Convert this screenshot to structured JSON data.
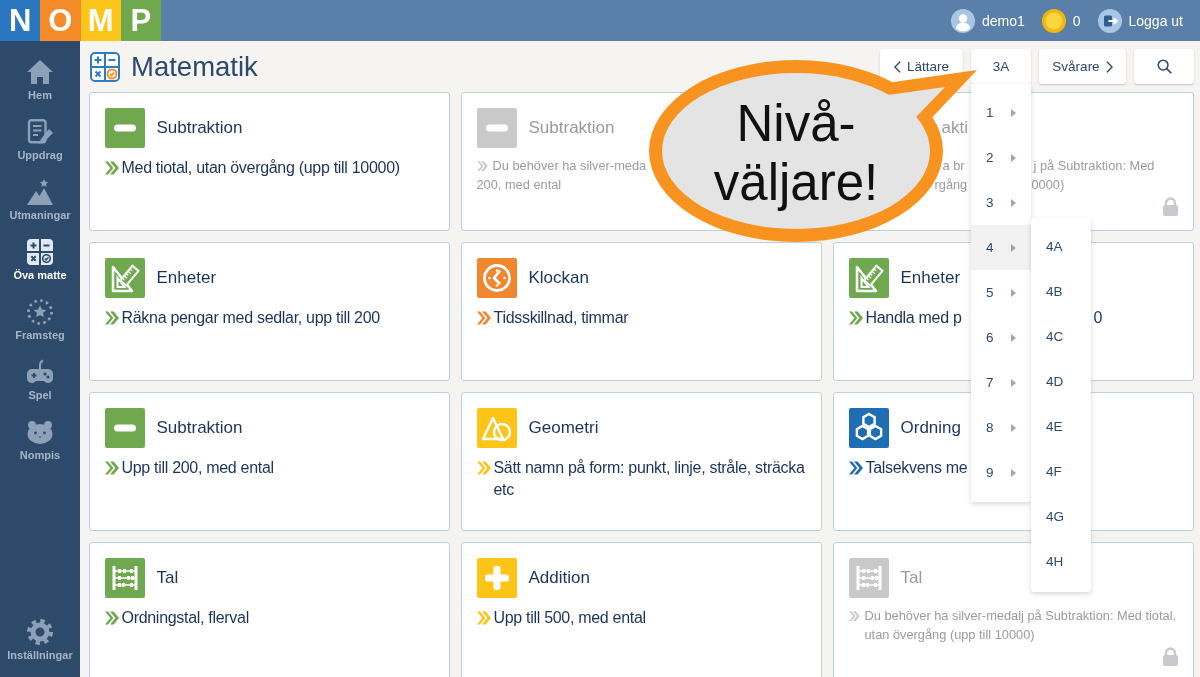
{
  "top_bar": {
    "logo": [
      {
        "letter": "N",
        "color": "#2b76c0"
      },
      {
        "letter": "O",
        "color": "#f58a2a"
      },
      {
        "letter": "M",
        "color": "#fcc51a"
      },
      {
        "letter": "P",
        "color": "#70a84e"
      }
    ],
    "user": "demo1",
    "coins": "0",
    "logout": "Logga ut"
  },
  "sidebar": {
    "items": [
      {
        "kind": "home",
        "label": "Hem",
        "selected": false
      },
      {
        "kind": "assignments",
        "label": "Uppdrag",
        "selected": false
      },
      {
        "kind": "challenges",
        "label": "Utmaningar",
        "selected": false
      },
      {
        "kind": "practice",
        "label": "Öva matte",
        "selected": true
      },
      {
        "kind": "progress",
        "label": "Framsteg",
        "selected": false
      },
      {
        "kind": "games",
        "label": "Spel",
        "selected": false
      },
      {
        "kind": "pet",
        "label": "Nompis",
        "selected": false
      }
    ],
    "footer_item": {
      "kind": "settings",
      "label": "Inställningar",
      "selected": false
    }
  },
  "header": {
    "title": "Matematik",
    "easier_button": "Lättare",
    "level_button": "3A",
    "harder_button": "Svårare"
  },
  "level_menu": {
    "items": [
      {
        "label": "1",
        "expanded": false
      },
      {
        "label": "2",
        "expanded": false
      },
      {
        "label": "3",
        "expanded": false
      },
      {
        "label": "4",
        "expanded": true,
        "submenu": [
          "4A",
          "4B",
          "4C",
          "4D",
          "4E",
          "4F",
          "4G",
          "4H"
        ]
      },
      {
        "label": "5",
        "expanded": false
      },
      {
        "label": "6",
        "expanded": false
      },
      {
        "label": "7",
        "expanded": false
      },
      {
        "label": "8",
        "expanded": false
      },
      {
        "label": "9",
        "expanded": false
      }
    ]
  },
  "cards": [
    {
      "kind": "subtraction",
      "color": "#6fa84e",
      "locked": false,
      "title": "Subtraktion",
      "description": "Med tiotal, utan övergång (upp till 10000)"
    },
    {
      "kind": "subtraction",
      "locked": true,
      "title": "Subtraktion",
      "description_parts": [
        [
          "Du behöver ha silver-meda"
        ],
        [
          "200, med ental"
        ]
      ]
    },
    {
      "locked": true,
      "title": "akti",
      "description_parts": [
        [
          "a br",
          "j på Subtraktion: Med"
        ],
        [
          "rgång",
          "0000)"
        ]
      ]
    },
    {
      "kind": "units",
      "color": "#6fa84e",
      "locked": false,
      "title": "Enheter",
      "description": "Räkna pengar med sedlar, upp till 200"
    },
    {
      "kind": "clock",
      "color": "#f0862e",
      "locked": false,
      "title": "Klockan",
      "description": "Tidsskillnad, timmar"
    },
    {
      "kind": "units",
      "color": "#6fa84e",
      "locked": false,
      "title": "Enheter",
      "description_parts": [
        [
          "Handla med p",
          "0"
        ]
      ]
    },
    {
      "kind": "subtraction",
      "color": "#6fa84e",
      "locked": false,
      "title": "Subtraktion",
      "description": "Upp till 200, med ental"
    },
    {
      "kind": "geometry",
      "color": "#fcc416",
      "locked": false,
      "title": "Geometri",
      "description": "Sätt namn på form: punkt, linje, stråle, sträcka etc"
    },
    {
      "kind": "ordering",
      "color": "#1f6db2",
      "locked": false,
      "title": "Ordning",
      "description_parts": [
        [
          "Talsekvens me"
        ]
      ]
    },
    {
      "kind": "numbers",
      "color": "#6fa84e",
      "locked": false,
      "title": "Tal",
      "description": "Ordningstal, flerval"
    },
    {
      "kind": "addition",
      "color": "#fcc416",
      "locked": false,
      "title": "Addition",
      "description": "Upp till 500, med ental"
    },
    {
      "kind": "numbers",
      "locked": true,
      "title": "Tal",
      "description": "Du behöver ha silver-medalj på Subtraktion: Med tiotal, utan övergång (upp till 10000)"
    }
  ],
  "callout": {
    "lines": [
      "Nivå-",
      "väljare!"
    ]
  }
}
